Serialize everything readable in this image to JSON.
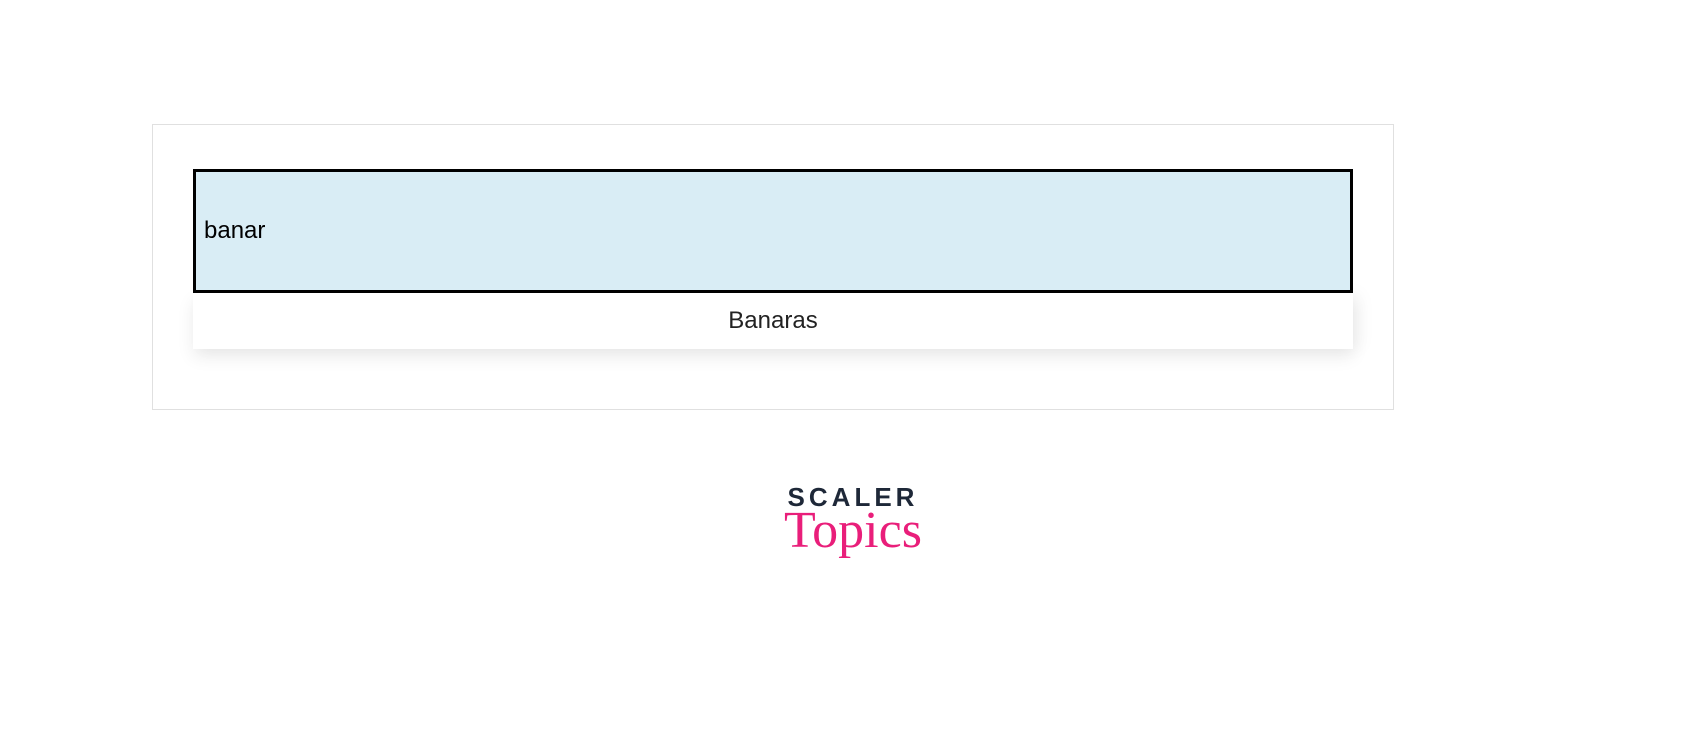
{
  "search": {
    "value": "banar"
  },
  "dropdown": {
    "items": [
      "Banaras"
    ]
  },
  "logo": {
    "line1": "SCALER",
    "line2": "Topics"
  }
}
